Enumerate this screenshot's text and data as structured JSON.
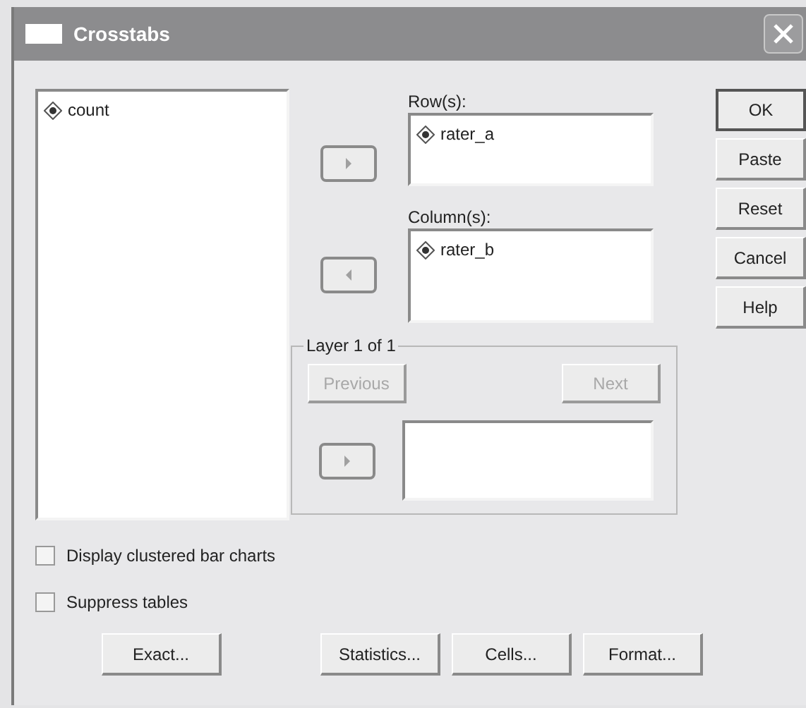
{
  "window": {
    "title": "Crosstabs"
  },
  "variables": [
    "count"
  ],
  "row_list": {
    "label": "Row(s):",
    "arrow_button": {
      "kind": "right"
    },
    "items": [
      "rater_a"
    ]
  },
  "column_list": {
    "label": "Column(s):",
    "arrow_button": {
      "kind": "left"
    },
    "items": [
      "rater_b"
    ]
  },
  "layer": {
    "title": "Layer 1 of 1",
    "arrow_button": {
      "kind": "right"
    },
    "buttons": [
      {
        "label": "Previous",
        "disabled": true
      },
      {
        "label": "Next",
        "disabled": true
      }
    ]
  },
  "side_buttons": [
    {
      "label": "OK",
      "default": true
    },
    {
      "label": "Paste",
      "default": false
    },
    {
      "label": "Reset",
      "default": false
    },
    {
      "label": "Cancel",
      "default": false
    },
    {
      "label": "Help",
      "default": false
    }
  ],
  "checkboxes": [
    {
      "label": "Display clustered bar charts",
      "checked": false
    },
    {
      "label": "Suppress tables",
      "checked": false
    }
  ],
  "bottom_buttons": [
    "Exact...",
    "Statistics...",
    "Cells...",
    "Format..."
  ]
}
